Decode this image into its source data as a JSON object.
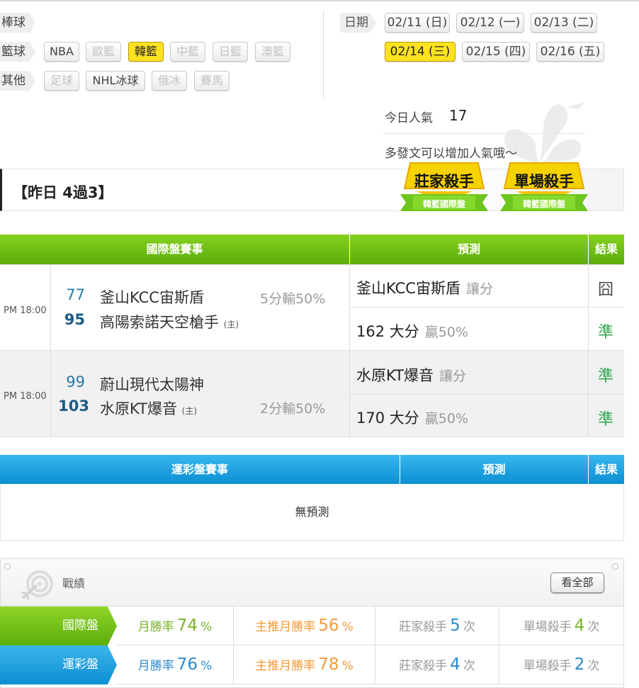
{
  "categories": {
    "baseball": {
      "label": "棒球"
    },
    "basketball": {
      "label": "籃球",
      "chips": [
        "NBA",
        "歐籃",
        "韓籃",
        "中籃",
        "日籃",
        "澳籃"
      ],
      "selected": "韓籃"
    },
    "other": {
      "label": "其他",
      "chips": [
        "足球",
        "NHL冰球",
        "俄冰",
        "賽馬"
      ]
    }
  },
  "date": {
    "label": "日期",
    "dates": [
      "02/11 (日)",
      "02/12 (一)",
      "02/13 (二)",
      "02/14 (三)",
      "02/15 (四)",
      "02/16 (五)"
    ],
    "selected": "02/14 (三)"
  },
  "popularity": {
    "label": "今日人氣",
    "value": "17",
    "hint": "多發文可以增加人氣哦～"
  },
  "yesterday": {
    "title": "【昨日 4過3】"
  },
  "badges": [
    {
      "title": "莊家殺手",
      "sub": "韓籃國際盤"
    },
    {
      "title": "單場殺手",
      "sub": "韓籃國際盤"
    }
  ],
  "intl_table": {
    "headers": {
      "event": "國際盤賽事",
      "pred": "預測",
      "result": "結果"
    },
    "rows": [
      {
        "time": "PM 18:00",
        "away_score": "77",
        "away_team": "釜山KCC宙斯盾",
        "home_score": "95",
        "home_team": "高陽索諾天空槍手",
        "host_tag": "(主)",
        "spread": "5分輸50%",
        "pred1": "釜山KCC宙斯盾",
        "pred1_sub": "讓分",
        "res1": "囧",
        "pred2": "162 大分",
        "pred2_sub": "贏50%",
        "res2": "準"
      },
      {
        "time": "PM 18:00",
        "away_score": "99",
        "away_team": "蔚山現代太陽神",
        "home_score": "103",
        "home_team": "水原KT爆音",
        "host_tag": "(主)",
        "spread": "2分輸50%",
        "pred1": "水原KT爆音",
        "pred1_sub": "讓分",
        "res1": "準",
        "pred2": "170 大分",
        "pred2_sub": "贏50%",
        "res2": "準"
      }
    ]
  },
  "lottery_table": {
    "headers": {
      "event": "運彩盤賽事",
      "pred": "預測",
      "result": "結果"
    },
    "empty": "無預測"
  },
  "record": {
    "title": "戰績",
    "view_all": "看全部",
    "rows": [
      {
        "label": "國際盤",
        "monthly_label": "月勝率",
        "monthly": "74",
        "pct": "%",
        "main_label": "主推月勝率",
        "main": "56",
        "dealer_label": "莊家殺手",
        "dealer": "5",
        "times": "次",
        "single_label": "單場殺手",
        "single": "4"
      },
      {
        "label": "運彩盤",
        "monthly_label": "月勝率",
        "monthly": "76",
        "pct": "%",
        "main_label": "主推月勝率",
        "main": "78",
        "dealer_label": "莊家殺手",
        "dealer": "4",
        "times": "次",
        "single_label": "單場殺手",
        "single": "2"
      }
    ]
  },
  "colors": {
    "green": "#6bbd12",
    "blue": "#1a9fe0",
    "yellow": "#ffe320",
    "win": "#2fa54a"
  }
}
